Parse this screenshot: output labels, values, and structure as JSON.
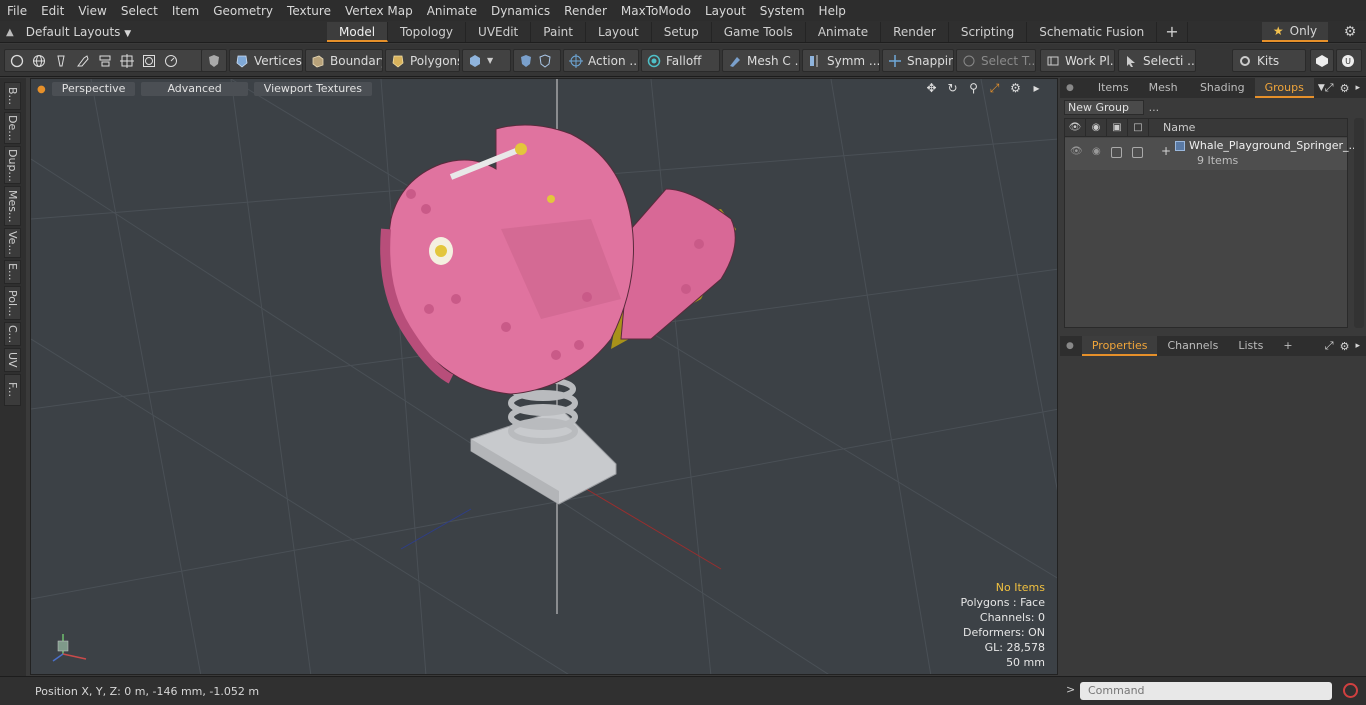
{
  "menu": [
    "File",
    "Edit",
    "View",
    "Select",
    "Item",
    "Geometry",
    "Texture",
    "Vertex Map",
    "Animate",
    "Dynamics",
    "Render",
    "MaxToModo",
    "Layout",
    "System",
    "Help"
  ],
  "layouts_label": "Default Layouts",
  "tabs": [
    "Model",
    "Topology",
    "UVEdit",
    "Paint",
    "Layout",
    "Setup",
    "Game Tools",
    "Animate",
    "Render",
    "Scripting",
    "Schematic Fusion"
  ],
  "tab_plus": "+",
  "only_label": "Only",
  "toolbar": {
    "vertices": "Vertices",
    "boundary": "Boundary",
    "polygons": "Polygons",
    "action": "Action ...",
    "falloff": "Falloff",
    "mesh": "Mesh C ...",
    "symm": "Symm ...",
    "snapping": "Snapping",
    "select_t": "Select T...",
    "work_pl": "Work Pl...",
    "selecti": "Selecti ...",
    "kits": "Kits"
  },
  "left_tabs": [
    "B...",
    "De...",
    "Dup...",
    "Mes...",
    "Ve...",
    "E...",
    "Pol...",
    "C...",
    "UV",
    "F..."
  ],
  "viewport": {
    "perspective": "Perspective",
    "advanced": "Advanced",
    "viewport_textures": "Viewport Textures"
  },
  "stats": {
    "no_items": "No Items",
    "polygons": "Polygons : Face",
    "channels": "Channels: 0",
    "deformers": "Deformers: ON",
    "gl": "GL: 28,578",
    "mm": "50 mm"
  },
  "status": {
    "position": "Position X, Y, Z:   0 m, -146 mm, -1.052 m"
  },
  "right_panel": {
    "tabs": [
      "Items",
      "Mesh ...",
      "Shading",
      "Groups"
    ],
    "new_group": "New Group",
    "name_col": "Name",
    "group_name": "Whale_Playground_Springer_...",
    "group_count": "9 Items",
    "prop_tabs": [
      "Properties",
      "Channels",
      "Lists"
    ],
    "prop_plus": "+",
    "command_placeholder": "Command"
  },
  "colors": {
    "accent": "#e6902a",
    "whale_pink": "#e0739f",
    "stats_highlight": "#f0c040"
  }
}
